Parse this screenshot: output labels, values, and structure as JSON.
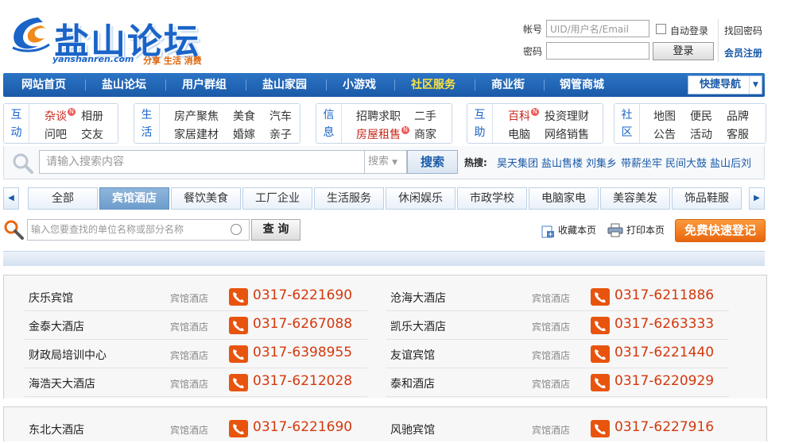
{
  "logo": {
    "name": "盐山论坛",
    "domain": "yanshanren.com",
    "slogan": "分享 生活 消费"
  },
  "login": {
    "account_label": "帐号",
    "account_placeholder": "UID/用户名/Email",
    "password_label": "密码",
    "auto_login": "自动登录",
    "login_button": "登录",
    "forgot": "找回密码",
    "register": "会员注册"
  },
  "nav": {
    "items": [
      "网站首页",
      "盐山论坛",
      "用户群组",
      "盐山家园",
      "小游戏",
      "社区服务",
      "商业街",
      "钢管商城"
    ],
    "quick": "快捷导航"
  },
  "categories": [
    {
      "head": [
        "互",
        "动"
      ],
      "links": [
        "杂谈",
        "相册",
        "问吧",
        "交友"
      ]
    },
    {
      "head": [
        "生",
        "活"
      ],
      "links": [
        "房产聚焦",
        "美食",
        "汽车",
        "家居建材",
        "婚嫁",
        "亲子"
      ]
    },
    {
      "head": [
        "信",
        "息"
      ],
      "links": [
        "招聘求职",
        "二手",
        "房屋租售",
        "商家"
      ]
    },
    {
      "head": [
        "互",
        "助"
      ],
      "links": [
        "百科",
        "投资理财",
        "电脑",
        "网络销售"
      ]
    },
    {
      "head": [
        "社",
        "区"
      ],
      "links": [
        "地图",
        "便民",
        "品牌",
        "公告",
        "活动",
        "客服"
      ]
    }
  ],
  "search": {
    "placeholder": "请输入搜索内容",
    "type": "搜索",
    "button": "搜索",
    "hot_label": "热搜:",
    "hot": [
      "昊天集团",
      "盐山售楼",
      "刘集乡",
      "带薪坐牢",
      "民间大鼓",
      "盐山后刘"
    ]
  },
  "tabs": [
    "全部",
    "宾馆酒店",
    "餐饮美食",
    "工厂企业",
    "生活服务",
    "休闲娱乐",
    "市政学校",
    "电脑家电",
    "美容美发",
    "饰品鞋服"
  ],
  "filter": {
    "placeholder": "输入您要查找的单位名称或部分名称",
    "query_button": "查 询",
    "favorite": "收藏本页",
    "print": "打印本页",
    "register": "免费快速登记"
  },
  "listings": [
    [
      {
        "name": "庆乐宾馆",
        "cat": "宾馆酒店",
        "tel": "0317-6221690"
      },
      {
        "name": "沧海大酒店",
        "cat": "宾馆酒店",
        "tel": "0317-6211886"
      },
      {
        "name": "金泰大酒店",
        "cat": "宾馆酒店",
        "tel": "0317-6267088"
      },
      {
        "name": "凯乐大酒店",
        "cat": "宾馆酒店",
        "tel": "0317-6263333"
      },
      {
        "name": "财政局培训中心",
        "cat": "宾馆酒店",
        "tel": "0317-6398955"
      },
      {
        "name": "友谊宾馆",
        "cat": "宾馆酒店",
        "tel": "0317-6221440"
      },
      {
        "name": "海浩天大酒店",
        "cat": "宾馆酒店",
        "tel": "0317-6212028"
      },
      {
        "name": "泰和酒店",
        "cat": "宾馆酒店",
        "tel": "0317-6220929"
      }
    ],
    [
      {
        "name": "东北大酒店",
        "cat": "宾馆酒店",
        "tel": "0317-6221690"
      },
      {
        "name": "风驰宾馆",
        "cat": "宾馆酒店",
        "tel": "0317-6227916"
      }
    ]
  ]
}
